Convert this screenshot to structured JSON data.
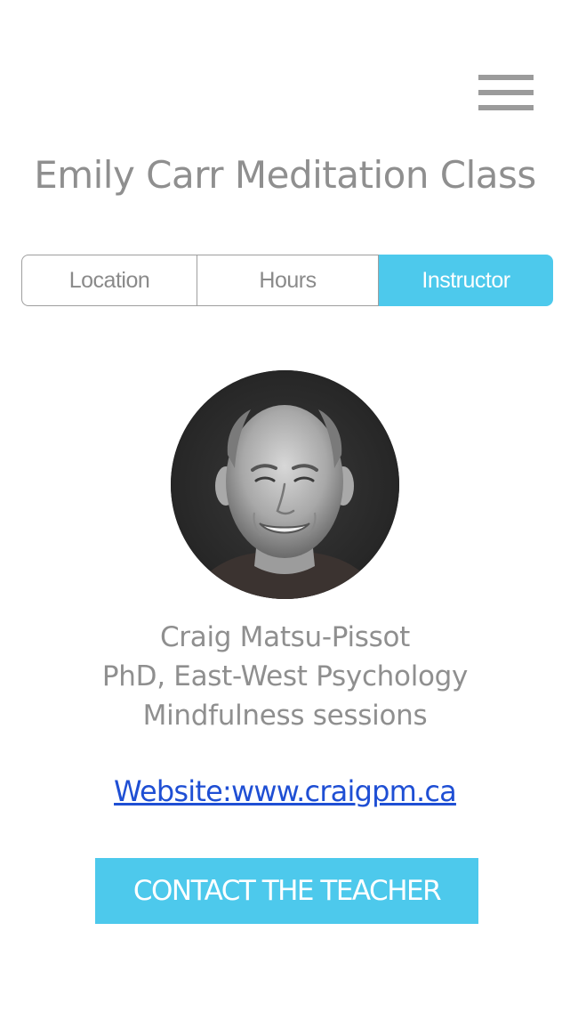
{
  "header": {
    "menu_icon": "hamburger-menu-icon",
    "title": "Emily Carr Meditation Class"
  },
  "tabs": [
    {
      "label": "Location",
      "active": false
    },
    {
      "label": "Hours",
      "active": false
    },
    {
      "label": "Instructor",
      "active": true
    }
  ],
  "instructor": {
    "photo": "instructor-photo",
    "name": "Craig Matsu-Pissot",
    "degree": "PhD, East-West Psychology",
    "sessions": "Mindfulness sessions",
    "website_label": "Website:www.craigpm.ca"
  },
  "contact_button": {
    "label": "CONTACT THE TEACHER"
  },
  "colors": {
    "accent": "#4dc9ec",
    "text_gray": "#8f8f8f",
    "link_blue": "#1f4fd4",
    "border_gray": "#9e9e9e"
  }
}
